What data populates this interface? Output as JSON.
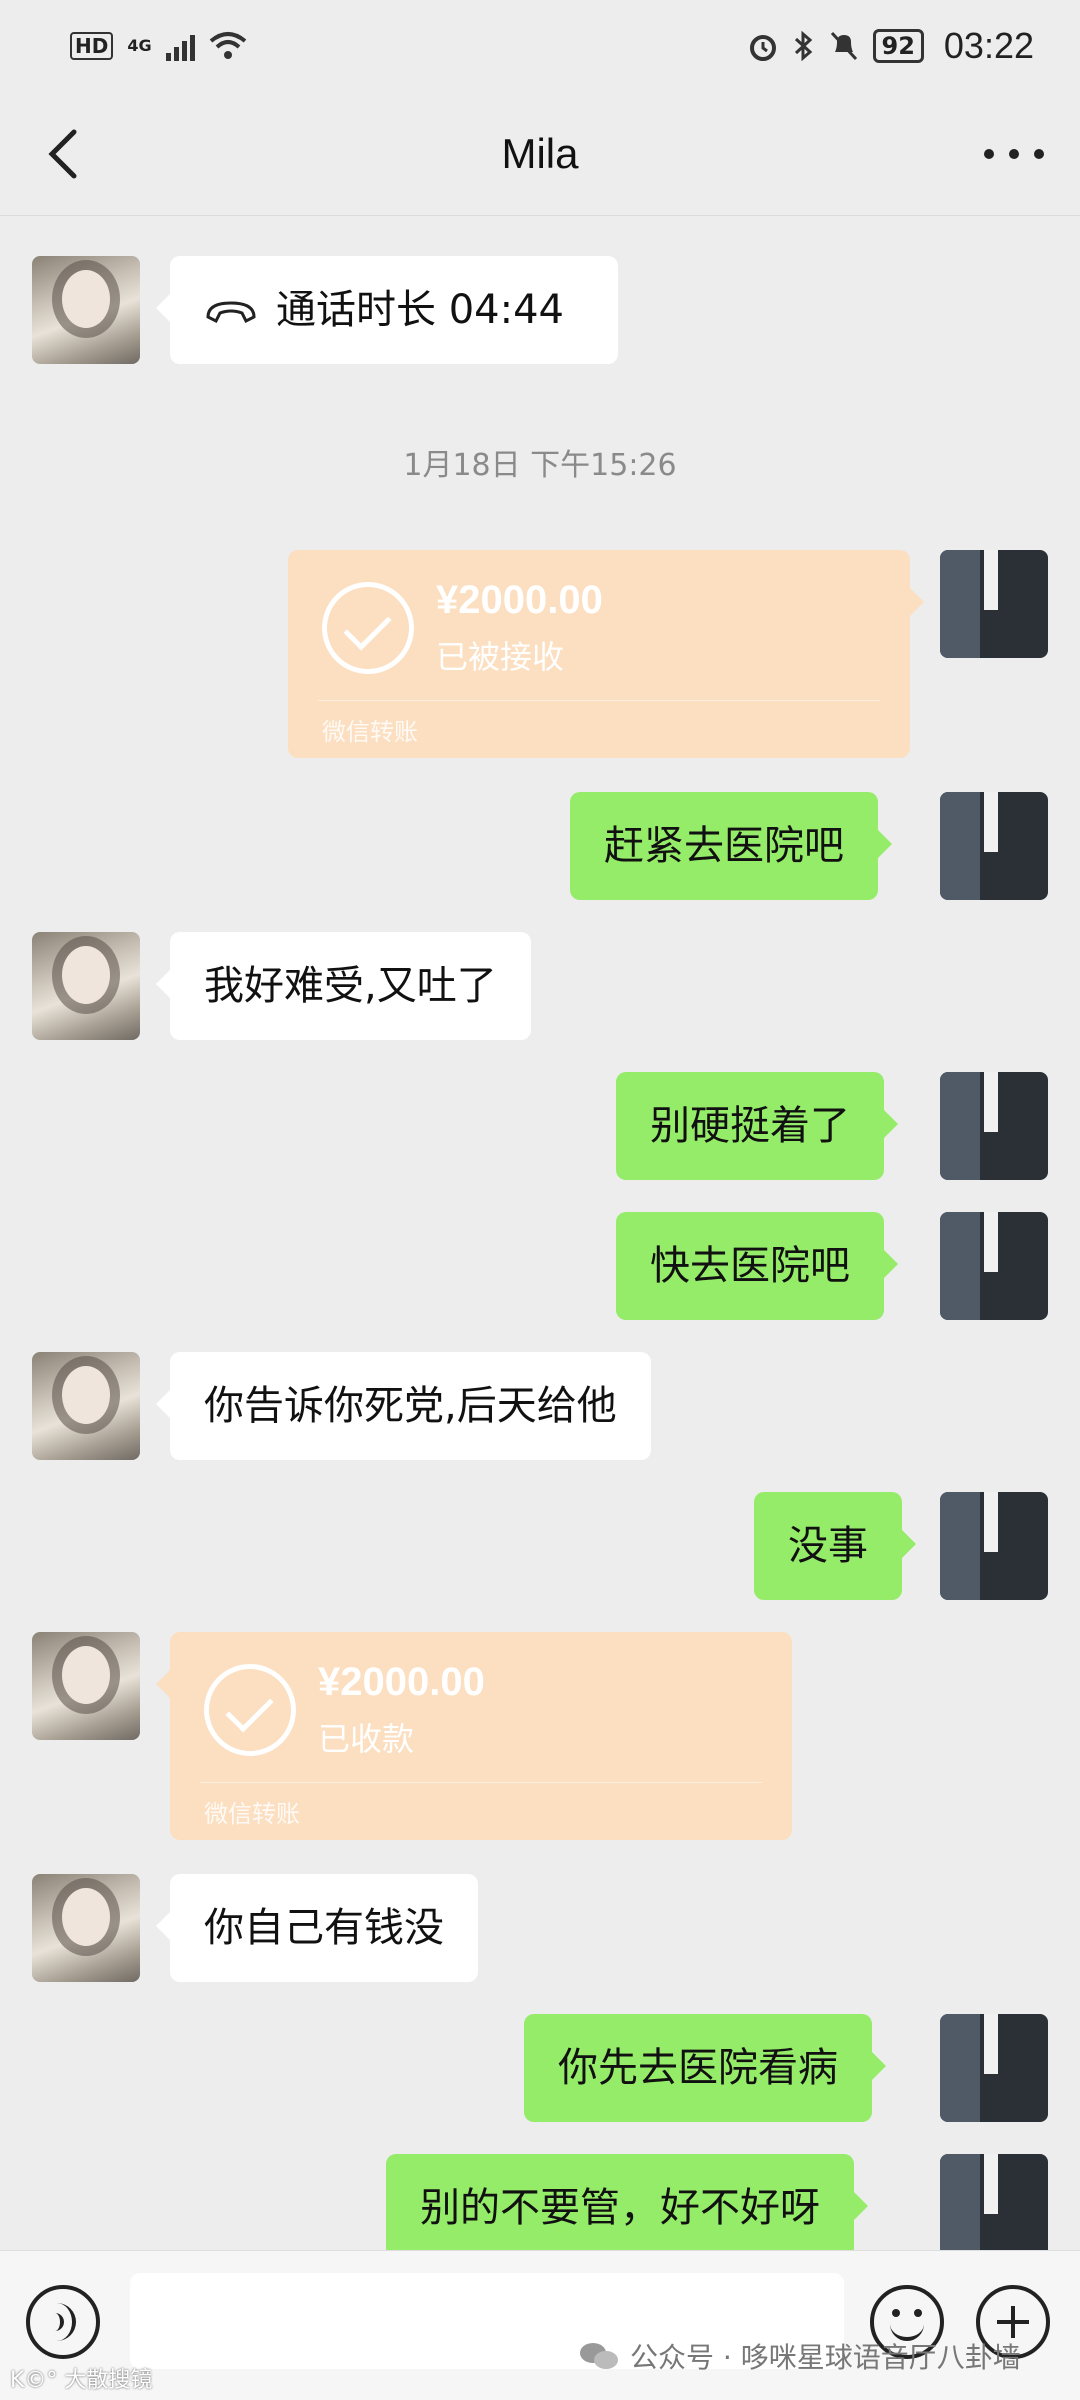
{
  "status_bar": {
    "hd": "HD",
    "network": "4G",
    "battery": "92",
    "time": "03:22"
  },
  "header": {
    "title": "Mila"
  },
  "messages": {
    "call": {
      "label": "通话时长 04:44"
    },
    "timestamp": "1月18日 下午15:26",
    "transfer_sent": {
      "amount": "¥2000.00",
      "status": "已被接收",
      "brand": "微信转账"
    },
    "m1": "赶紧去医院吧",
    "m2": "我好难受,又吐了",
    "m3": "别硬挺着了",
    "m4": "快去医院吧",
    "m5": "你告诉你死党,后天给他",
    "m6": "没事",
    "transfer_received": {
      "amount": "¥2000.00",
      "status": "已收款",
      "brand": "微信转账"
    },
    "m7": "你自己有钱没",
    "m8": "你先去医院看病",
    "m9": "别的不要管，好不好呀"
  },
  "watermarks": {
    "left": "K©° 大散搜镜",
    "right": "公众号 · 哆咪星球语音厅八卦墙"
  },
  "icons": {
    "back": "chevron-left-icon",
    "more": "more-dots-icon",
    "phone": "phone-hangup-icon",
    "voice": "voice-icon",
    "emoji": "emoji-icon",
    "plus": "plus-icon"
  },
  "colors": {
    "background": "#ededed",
    "bubble_green": "#95ec69",
    "bubble_white": "#ffffff",
    "transfer": "#fbdfc0"
  }
}
